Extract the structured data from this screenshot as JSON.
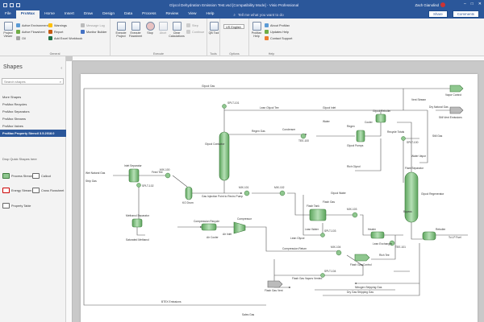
{
  "window": {
    "title": "Glycol Dehydration Emission Test.vsd [Compatibility Mode] - Visio Professional",
    "user": "Zach Gianolind",
    "min": "–",
    "max": "□",
    "close": "✕"
  },
  "tabs": [
    {
      "label": "File"
    },
    {
      "label": "ProMax",
      "active": true
    },
    {
      "label": "Home"
    },
    {
      "label": "Insert"
    },
    {
      "label": "Draw"
    },
    {
      "label": "Design"
    },
    {
      "label": "Data"
    },
    {
      "label": "Process"
    },
    {
      "label": "Review"
    },
    {
      "label": "View"
    },
    {
      "label": "Help"
    }
  ],
  "tell_me": "Tell me what you want to do",
  "share_label": "Share",
  "comments_label": "Comments",
  "ribbon": {
    "general": {
      "name": "General",
      "project_viewer": "Project Viewer",
      "active_environment": "Active Environment",
      "active_flowsheet": "Active Flowsheet",
      "oil": "Oil",
      "warnings": "Warnings",
      "report": "Report",
      "add_excel_workbook": "Add Excel Workbook",
      "message_log": "Message Log",
      "monitor_builder": "Monitor Builder"
    },
    "execute": {
      "name": "Execute",
      "execute_project": "Execute Project",
      "execute_flowsheet": "Execute Flowsheet",
      "stop": "Stop",
      "abort": "Abort",
      "clear_calculations": "Clear Calculations",
      "step": "Step",
      "continue": "Continue"
    },
    "tools": {
      "name": "Tools",
      "qb_tool": "QB Tool"
    },
    "options": {
      "name": "Options",
      "units": "US English"
    },
    "help": {
      "name": "Help",
      "promax_help": "ProMax Help",
      "about": "About ProMax",
      "updates": "Updates Help",
      "support": "Contact Support"
    }
  },
  "shapes_panel": {
    "title": "Shapes",
    "search_placeholder": "Search shapes",
    "stencils": [
      "More Shapes",
      "ProMax Recycles",
      "ProMax Separators",
      "ProMax Streams",
      "ProMax Valves",
      "ProMax Property Stencil 3.5.2018.0"
    ],
    "drop_quick": "Drop Quick Shapes here",
    "masters": [
      "Process Stream",
      "Callout",
      "Energy Stream",
      "Cross Flowsheet",
      "Property Table"
    ]
  },
  "diagram": {
    "labels": {
      "top_loop": "Glycol Gas",
      "lean_tee": "Lean Glycol Tee",
      "cooler": "Cooler",
      "pump": "Glycol Pumps",
      "reboiler": "Glycol Reboiler",
      "recycle": "Recycle Totals",
      "flare_sp": "Flare Separator",
      "flare_lbl": "Dry Natural Gas",
      "inlet": "Wet Natural Gas",
      "separator": "Inlet Separator",
      "contactor": "Glycol Contactor",
      "kod": "KO Drum",
      "still": "Glycol Regenerator",
      "flash": "Flash Tank",
      "comp_recycle": "Compression Recycle",
      "compressor": "Compressor",
      "aircooler": "Air Cooler",
      "sat_water": "Saturated Methanol",
      "methanol": "Methanol Separator",
      "lean_exch": "Lean Exchanger",
      "reboil_out": "Reboiler",
      "vapor_ctrl": "Vapor Control",
      "vent": "Still Vent Emissions",
      "flash_ctrl": "Flash Gas Control",
      "flash_vent": "Flash Gas Vent",
      "flash_gas_vapors": "Flash Gas Vapors Vented",
      "stripping_gas": "Nitrogen Stripping Gas",
      "dry_gas": "Dry Gas Stripping Gas",
      "comp_return": "Compression Return",
      "to_contactor": "Gas Injection Point to Recirc Pump",
      "glycol_water": "Glycol Water",
      "rich_glycol": "Rich Glycol",
      "mix_a": "MIX-100",
      "mix_b": "MIX-101",
      "mix_c": "MIX-102",
      "mix_d": "MIX-103",
      "mix_e": "MIX-104",
      "spl_a": "SPLT-100",
      "spl_b": "SPLT-101",
      "spl_c": "SPLT-102",
      "spl_d": "SPLT-103",
      "spl_e": "SPLT-104",
      "condenser": "Condenser",
      "flash_gas": "Flash Gas",
      "water_vapor": "Water Vapor",
      "regen_gas": "Regen Gas",
      "feed_tee": "Feed Tee",
      "rich_tee": "Rich Tee",
      "lean_water": "Lean Water",
      "heater": "Heater",
      "vent_stream": "Vent Stream",
      "air_in": "Air Inlet",
      "to_lp": "To LP Fuel",
      "still_gas": "Still Gas",
      "strip_gas_in": "Strip Gas",
      "btex": "BTEX Emissions",
      "sales_gas": "Sales Gas",
      "glycol_in": "Glycol Inlet",
      "tee_a": "TEE-100",
      "tee_b": "TEE-101",
      "regen": "Regen",
      "bypass": "Bypass",
      "lean_glycol": "Lean Glycol",
      "water": "Water"
    }
  },
  "colors": {
    "brand": "#2b579a",
    "equipment": "#8fc78f",
    "equipment_stroke": "#3d7a3d",
    "stream": "#555555"
  }
}
